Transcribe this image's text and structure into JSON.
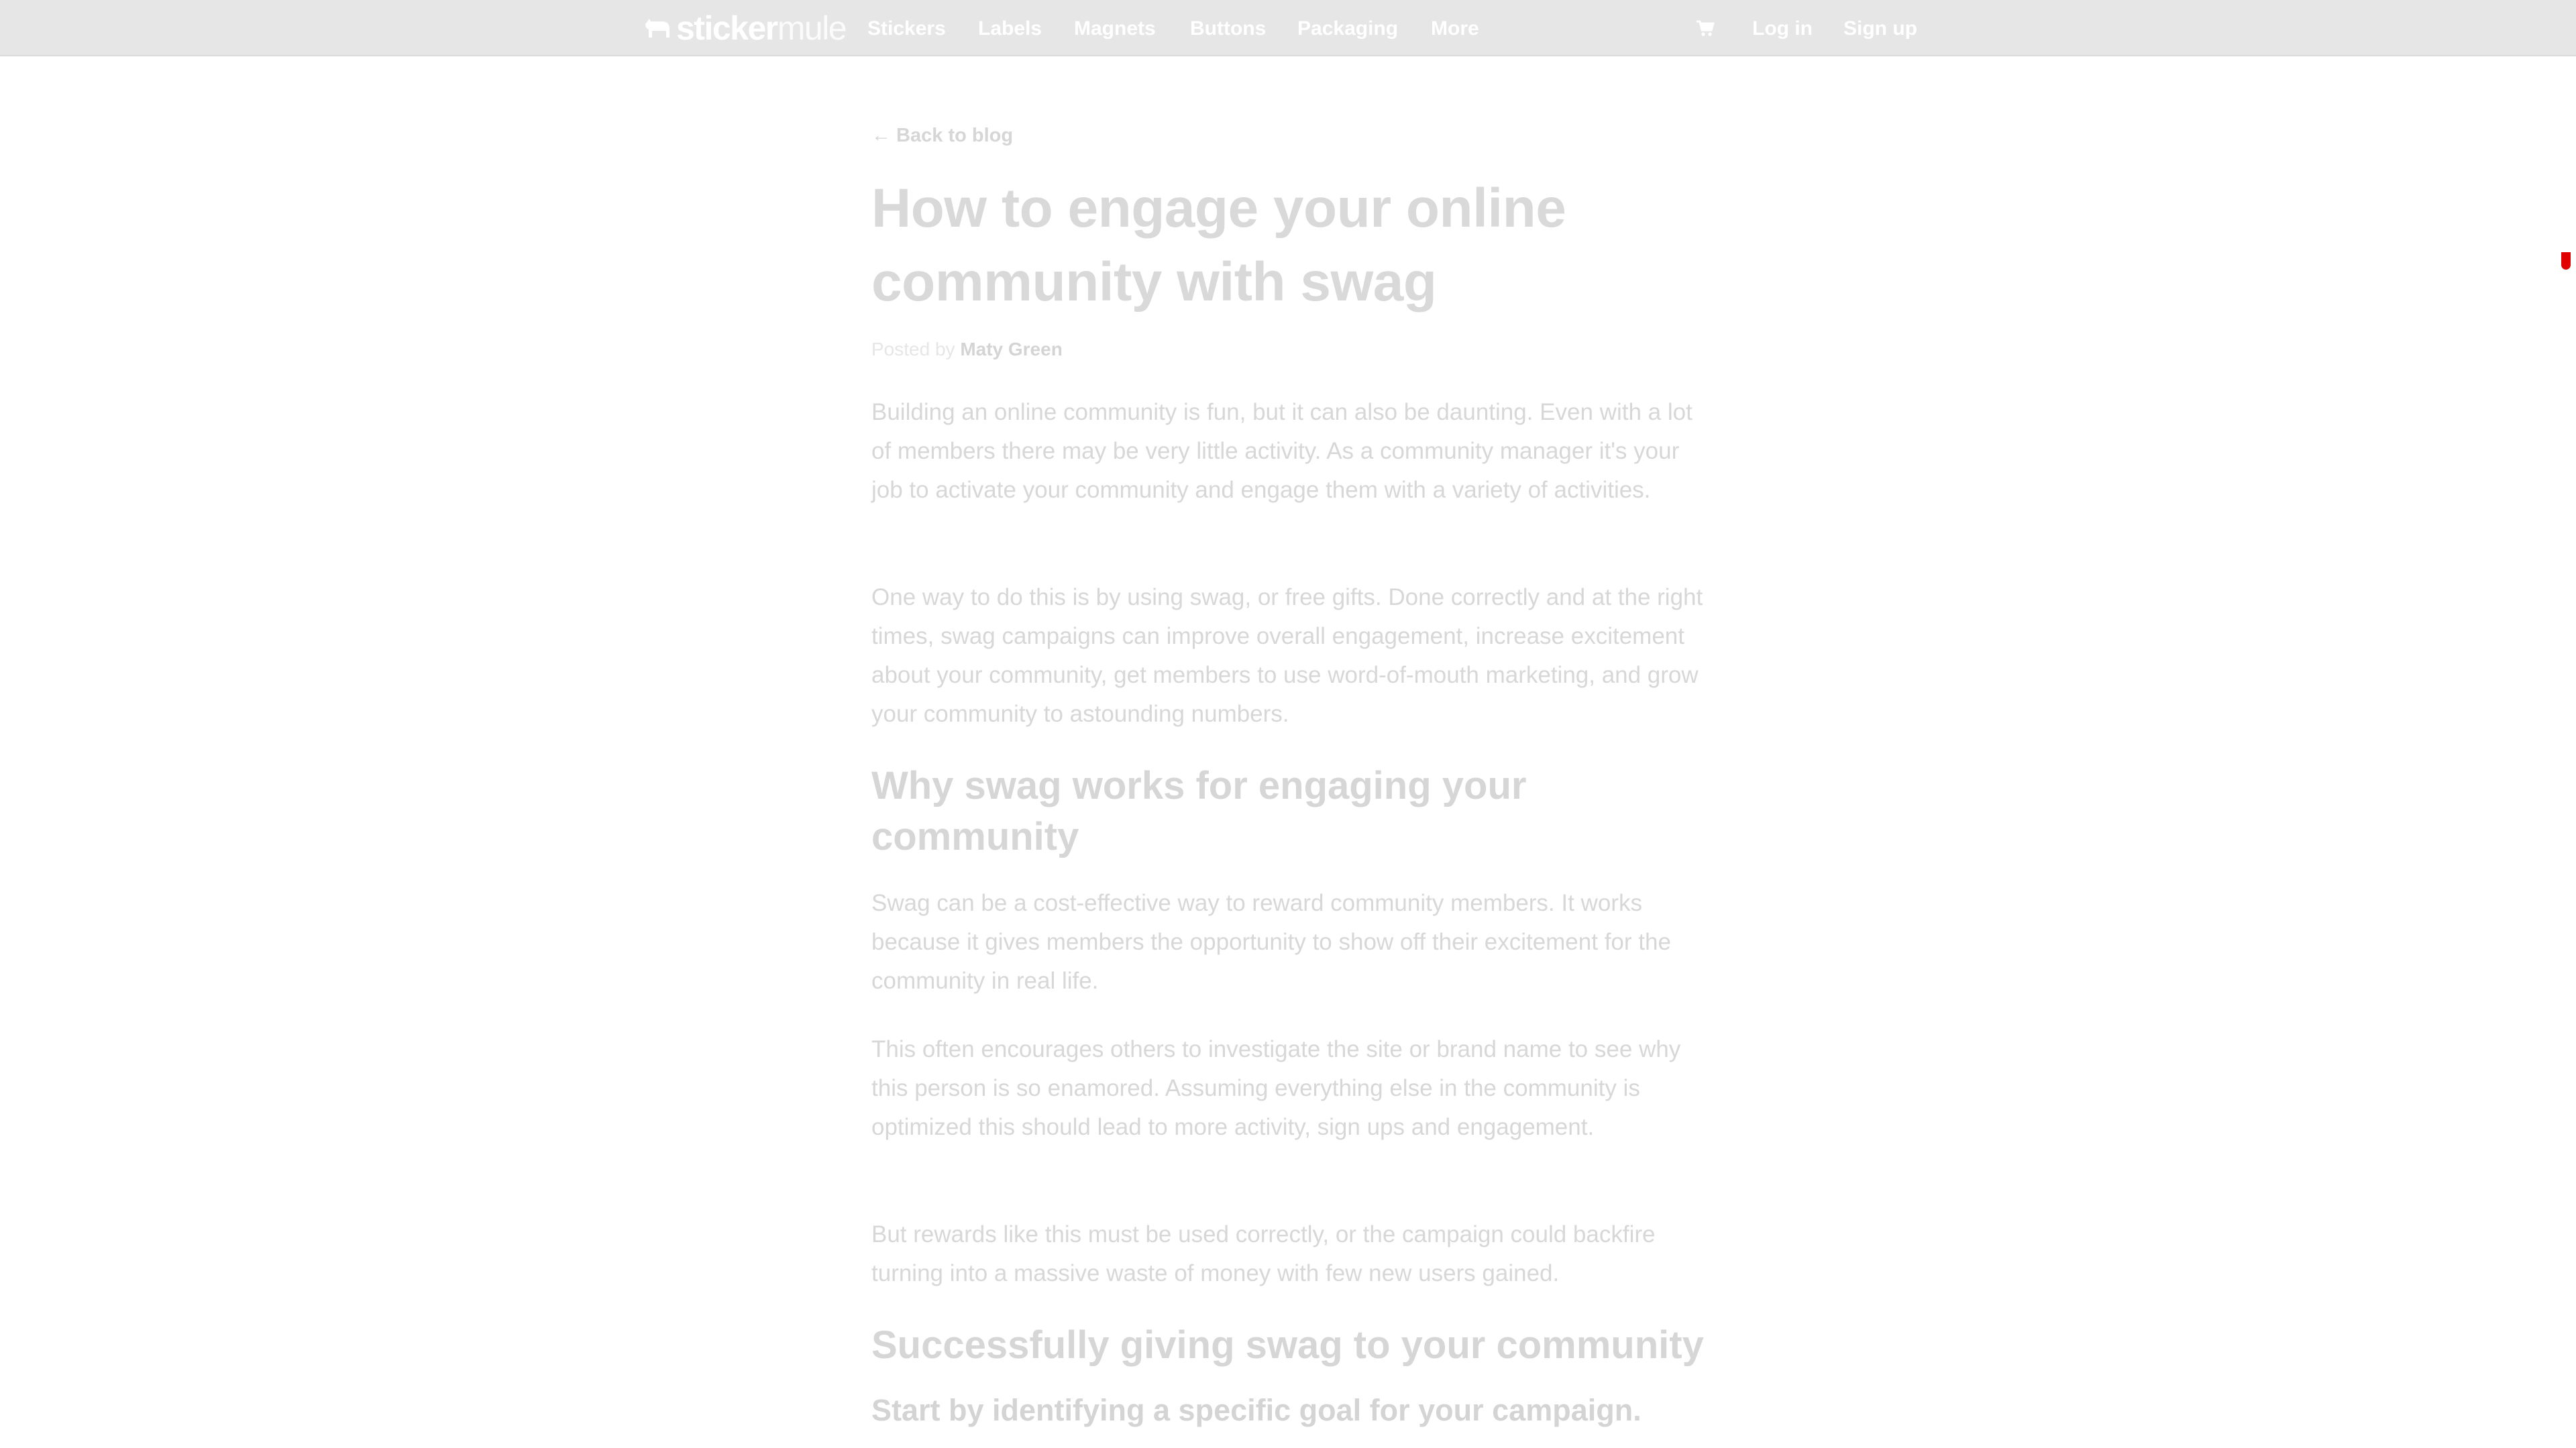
{
  "nav": {
    "logo_text_bold": "sticker",
    "logo_text_light": "mule",
    "links": [
      {
        "label": "Stickers"
      },
      {
        "label": "Labels"
      },
      {
        "label": "Magnets"
      },
      {
        "label": "Buttons"
      },
      {
        "label": "Packaging"
      },
      {
        "label": "More"
      }
    ],
    "cart_icon": "shopping-cart-icon",
    "login_label": "Log in",
    "signup_label": "Sign up"
  },
  "article": {
    "back_link": "← Back to blog",
    "title": "How to engage your online community with swag",
    "byline_prefix": "Posted by",
    "author": "Maty Green",
    "paragraphs": [
      "Building an online community is fun, but it can also be daunting. Even with a lot of members there may be very little activity. As a community manager it's your job to activate your community and engage them with a variety of activities.",
      "One way to do this is by using swag, or free gifts. Done correctly and at the right times, swag campaigns can improve overall engagement, increase excitement about your community, get members to use word-of-mouth marketing, and grow your community to astounding numbers.",
      "Swag can be a cost-effective way to reward community members. It works because it gives members the opportunity to show off their excitement for the community in real life.",
      "This often encourages others to investigate the site or brand name to see why this person is so enamored. Assuming everything else in the community is optimized this should lead to more activity, sign ups and engagement.",
      "But rewards like this must be used correctly, or the campaign could backfire turning into a massive waste of money with few new users gained."
    ],
    "heading_why": "Why swag works for engaging your community",
    "heading_success": "Successfully giving swag to your community",
    "subheading_goal": "Start by identifying a specific goal for your campaign."
  },
  "colors": {
    "topbar_bg": "#e6e6e6",
    "text_faded": "#d7d7d7",
    "scroll_indicator": "#e00000"
  }
}
